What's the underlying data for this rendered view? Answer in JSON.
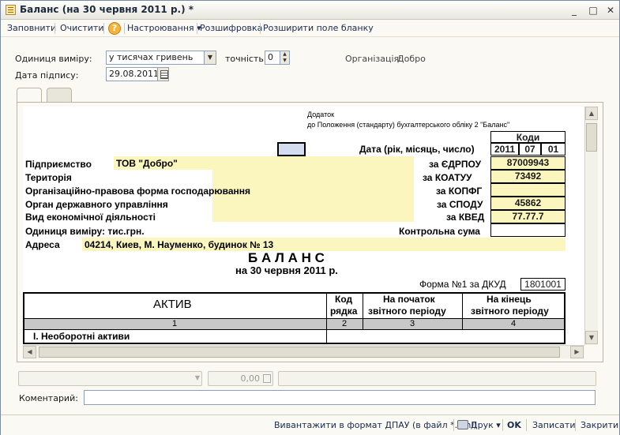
{
  "window": {
    "title": "Баланс (на 30 червня 2011 р.) *"
  },
  "toolbar": {
    "fill": "Заповнити",
    "clear": "Очистити",
    "settings": "Настроювання ▾",
    "decode": "Розшифровка",
    "expand": "Розширити поле бланку"
  },
  "form": {
    "unit_label": "Одиниця виміру:",
    "unit_value": "у тисячах гривень",
    "precision_label": "точність:",
    "precision_value": "0",
    "org_label": "Організація:",
    "org_value": "Добро",
    "date_label": "Дата підпису:",
    "date_value": "29.08.2011"
  },
  "sheet": {
    "appendix_1": "Додаток",
    "appendix_2": "до Положення (стандарту) бухгалтерського обліку 2 \"Баланс\"",
    "codes_header": "Коди",
    "date_label": "Дата (рік, місяць, число)",
    "year": "2011",
    "month": "07",
    "day": "01",
    "enterprise_label": "Підприємство",
    "enterprise_value": "ТОВ \"Добро\"",
    "edrpou_label": "за ЄДРПОУ",
    "edrpou_value": "87009943",
    "territory_label": "Територія",
    "koatuu_label": "за КОАТУУ",
    "koatuu_value": "73492",
    "legal_form_label": "Організаційно-правова форма господарювання",
    "kopfg_label": "за КОПФГ",
    "kopfg_value": "",
    "authority_label": "Орган державного управління",
    "spodu_label": "за СПОДУ",
    "spodu_value": "45862",
    "activity_label": "Вид економічної діяльності",
    "kved_label": "за КВЕД",
    "kved_value": "77.77.7",
    "unit_label": "Одиниця виміру: тис.грн.",
    "checksum_label": "Контрольна сума",
    "address_label": "Адреса",
    "address_value": "04214, Киев, М. Науменко, будинок № 13",
    "title": "Б А Л А Н С",
    "subtitle": "на 30 червня 2011 р.",
    "form_label": "Форма №1 за ДКУД",
    "form_code": "1801001",
    "table": {
      "headers": [
        "АКТИВ",
        "Код рядка",
        "На початок звітного періоду",
        "На кінець звітного періоду"
      ],
      "header_lines": {
        "code_1": "Код",
        "code_2": "рядка",
        "start_1": "На початок",
        "start_2": "звітного періоду",
        "end_1": "На кінець",
        "end_2": "звітного періоду"
      },
      "numbers": [
        "1",
        "2",
        "3",
        "4"
      ],
      "section_1": "І. Необоротні  активи"
    }
  },
  "footer_fields": {
    "amount": "0,00",
    "comment_label": "Коментарий:"
  },
  "bottombar": {
    "export": "Вивантажити в формат ДПАУ (в файл *.xml)",
    "print": "Друк ▾",
    "ok": "OK",
    "save": "Записати",
    "close": "Закрити"
  }
}
